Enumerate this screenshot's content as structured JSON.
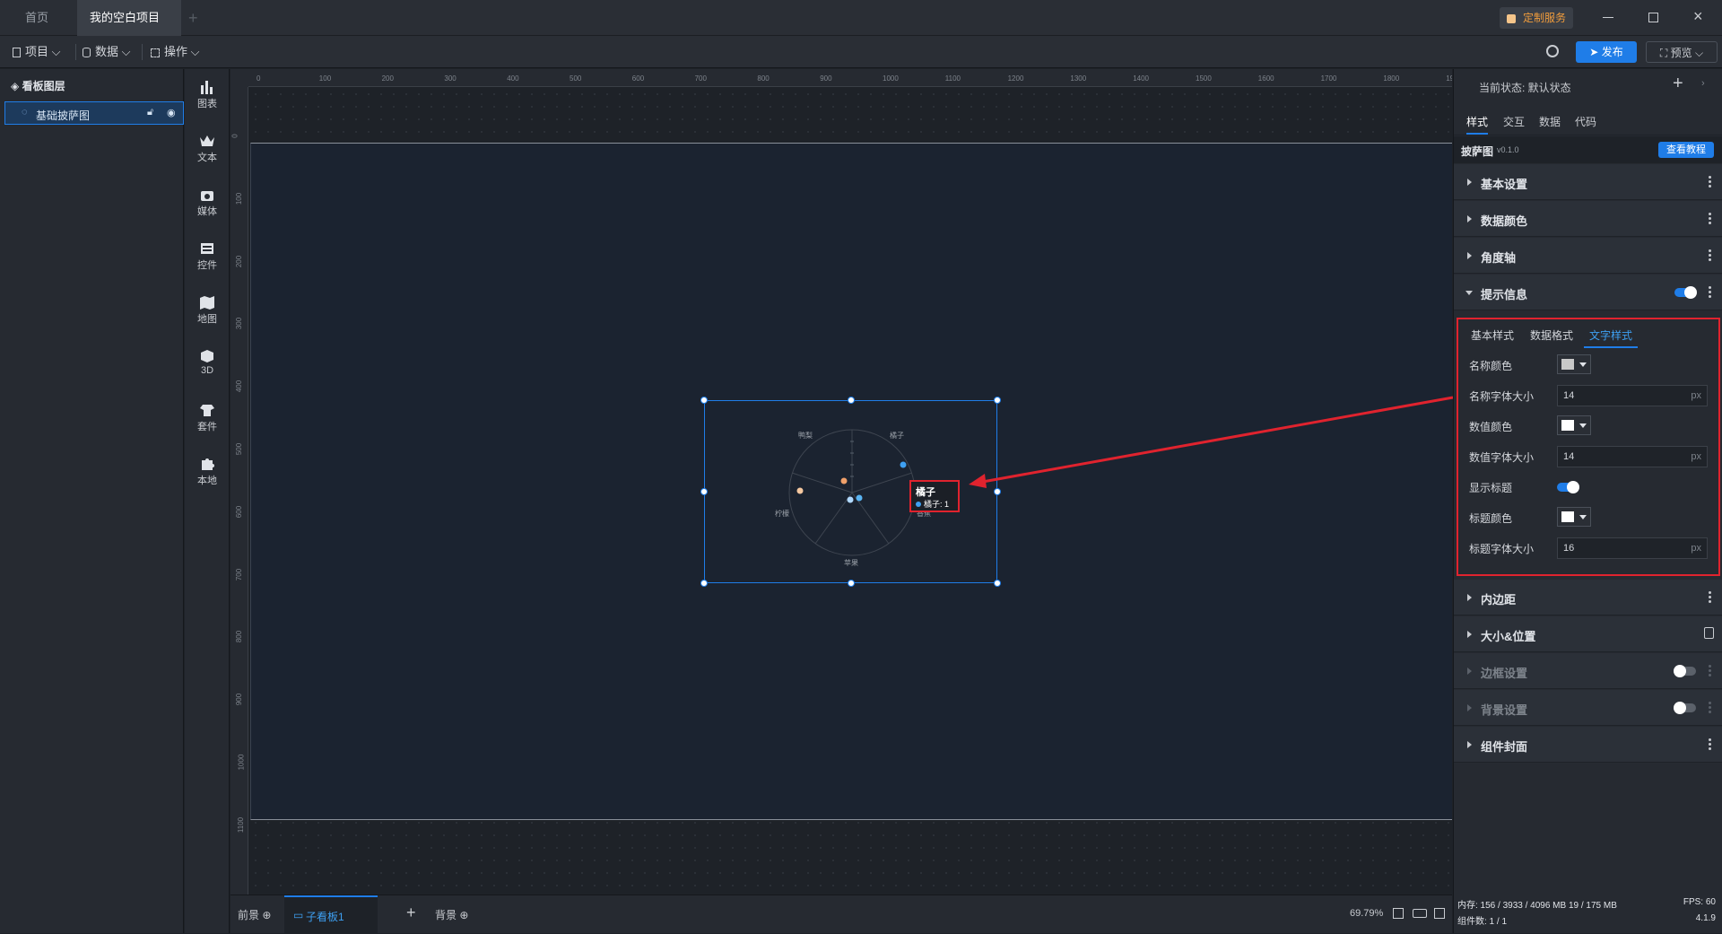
{
  "titlebar": {
    "tabs": [
      {
        "label": "首页"
      },
      {
        "label": "我的空白项目"
      }
    ],
    "custom_service": "定制服务"
  },
  "toolbar": {
    "project": "项目",
    "data": "数据",
    "operate": "操作",
    "publish": "发布",
    "preview": "预览"
  },
  "layers": {
    "title": "看板图层",
    "items": [
      {
        "label": "基础披萨图"
      }
    ]
  },
  "iconbar": {
    "items": [
      {
        "label": "图表",
        "icon": "chart-icon"
      },
      {
        "label": "文本",
        "icon": "text-icon"
      },
      {
        "label": "媒体",
        "icon": "media-icon"
      },
      {
        "label": "控件",
        "icon": "control-icon"
      },
      {
        "label": "地图",
        "icon": "map-icon"
      },
      {
        "label": "3D",
        "icon": "cube-icon"
      },
      {
        "label": "套件",
        "icon": "kit-icon"
      },
      {
        "label": "本地",
        "icon": "puzzle-icon"
      }
    ]
  },
  "ruler": {
    "h_ticks": [
      "0",
      "100",
      "200",
      "300",
      "400",
      "500",
      "600",
      "700",
      "800",
      "900",
      "1000",
      "1100",
      "1200",
      "1300",
      "1400",
      "1500",
      "1600",
      "1700",
      "1800",
      "1900"
    ],
    "v_ticks": [
      "0",
      "100",
      "200",
      "300",
      "400",
      "500",
      "600",
      "700",
      "800",
      "900",
      "1000",
      "1100"
    ]
  },
  "chart": {
    "labels": [
      "鸭梨",
      "橘子",
      "柠檬",
      "苹果",
      "香蕉"
    ],
    "tooltip_title": "橘子",
    "tooltip_value": "橘子:  1"
  },
  "bottombar": {
    "foreground": "前景",
    "sub_board": "子看板1",
    "background": "背景",
    "zoom": "69.79%"
  },
  "status": {
    "memory": "内存:  156 / 3933 / 4096 MB  19 / 175 MB",
    "components": "组件数: 1 / 1",
    "fps": "FPS:  60",
    "version": "4.1.9"
  },
  "rightpanel": {
    "state": "当前状态:  默认状态",
    "tabs": [
      "样式",
      "交互",
      "数据",
      "代码"
    ],
    "component_name": "披萨图",
    "version": "v0.1.0",
    "tutorial": "查看教程",
    "sections": {
      "basic": "基本设置",
      "data_color": "数据颜色",
      "angle_axis": "角度轴",
      "tooltip": "提示信息",
      "padding": "内边距",
      "size_pos": "大小&位置",
      "border": "边框设置",
      "bg": "背景设置",
      "cover": "组件封面"
    },
    "subtabs": [
      "基本样式",
      "数据格式",
      "文字样式"
    ],
    "props": {
      "name_color": "名称颜色",
      "name_size_label": "名称字体大小",
      "name_size": "14",
      "value_color": "数值颜色",
      "value_size_label": "数值字体大小",
      "value_size": "14",
      "show_title": "显示标题",
      "title_color": "标题颜色",
      "title_size_label": "标题字体大小",
      "title_size": "16",
      "unit": "px"
    }
  },
  "colors": {
    "accent": "#1f7de8",
    "highlight_red": "#e0232e"
  }
}
